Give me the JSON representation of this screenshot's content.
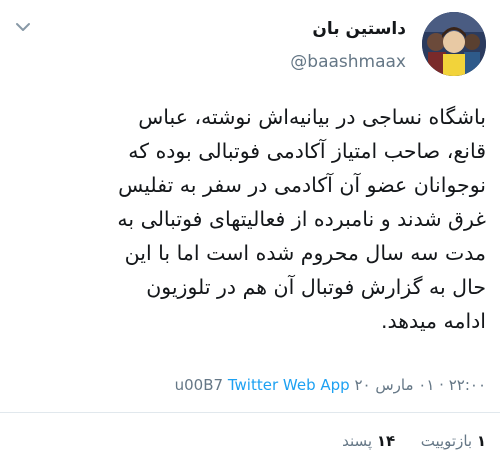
{
  "author": {
    "display_name": "داستین بان",
    "handle": "@baashmaax"
  },
  "tweet": {
    "text": "باشگاه نساجی در بیانیه‌اش نوشته، عباس\nقانع، صاحب امتیاز آکادمی فوتبالی بوده که\nنوجوانان عضو آن آکادمی در سفر به تفلیس\nغرق شدند و نامبرده از فعالیتهای فوتبالی به\nمدت سه سال محروم شده است اما با این\nحال به گزارش فوتبال آن هم در تلوزیون\nادامه میدهد."
  },
  "meta": {
    "timestamp": "۲۲:۰۰ · ۰۱ مارس ۲۰",
    "separator": "u00B7",
    "source": "Twitter Web App"
  },
  "stats": {
    "retweets_count": "۱",
    "retweets_label": "بازتوییت",
    "likes_count": "۱۴",
    "likes_label": "پسند"
  },
  "icons": {
    "menu": "chevron-down-icon"
  }
}
